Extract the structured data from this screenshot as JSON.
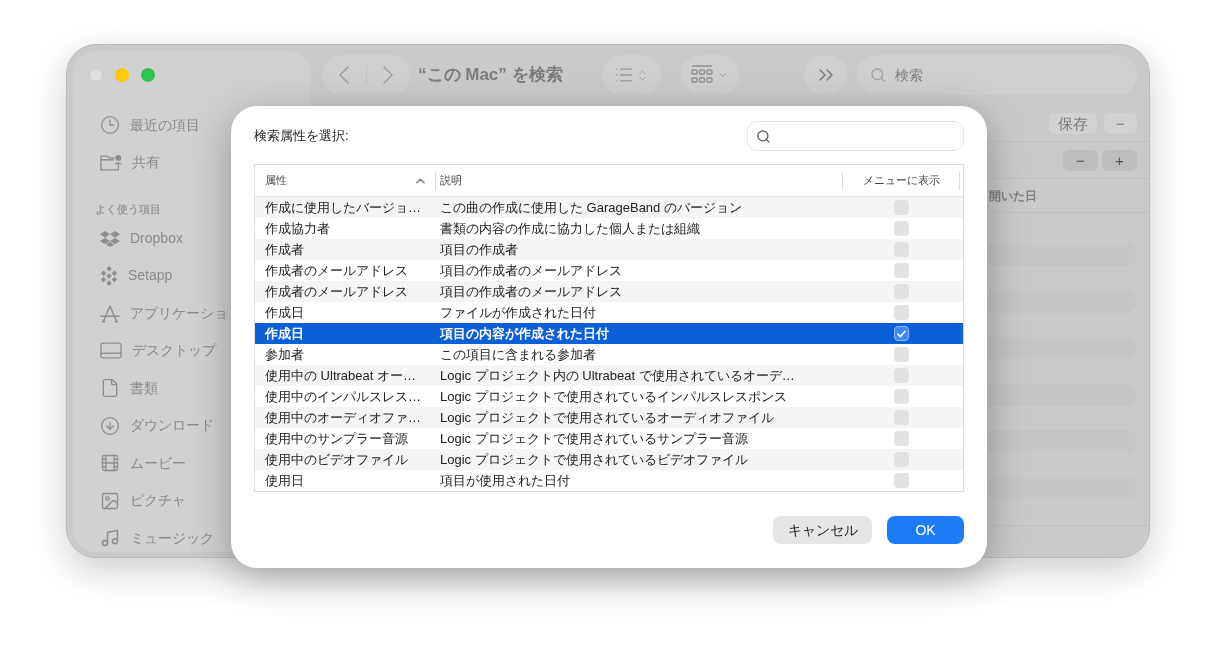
{
  "finder": {
    "title": "“この Mac” を検索",
    "search": {
      "placeholder": "検索"
    },
    "sidebar": {
      "items": [
        {
          "label": "最近の項目"
        },
        {
          "label": "共有"
        }
      ],
      "favorites": {
        "heading": "よく使う項目",
        "items": [
          {
            "label": "Dropbox"
          },
          {
            "label": "Setapp"
          },
          {
            "label": "アプリケーショ"
          },
          {
            "label": "デスクトップ"
          },
          {
            "label": "書類"
          },
          {
            "label": "ダウンロード"
          },
          {
            "label": "ムービー"
          },
          {
            "label": "ピクチャ"
          },
          {
            "label": "ミュージック"
          }
        ]
      }
    },
    "query_bar": {
      "buttons": [
        {
          "label": "保存",
          "disabled": true
        },
        {
          "label": "−",
          "disabled": true
        }
      ]
    },
    "criteria_bar": {
      "buttons": [
        {
          "label": "−",
          "disabled": false
        },
        {
          "label": "+",
          "disabled": false
        }
      ]
    },
    "columns": [
      {
        "label": "開いた日"
      }
    ]
  },
  "dialog": {
    "title": "検索属性を選択:",
    "table": {
      "columns": [
        {
          "label": "属性",
          "sorted": true
        },
        {
          "label": "説明",
          "sorted": false
        },
        {
          "label": "メニューに表示",
          "sorted": false
        }
      ],
      "rows": [
        {
          "attribute": "作成に使用したバージョ…",
          "description": "この曲の作成に使用した GarageBand のバージョン",
          "selected": false,
          "checked": false
        },
        {
          "attribute": "作成協力者",
          "description": "書類の内容の作成に協力した個人または組織",
          "selected": false,
          "checked": false
        },
        {
          "attribute": "作成者",
          "description": "項目の作成者",
          "selected": false,
          "checked": false
        },
        {
          "attribute": "作成者のメールアドレス",
          "description": "項目の作成者のメールアドレス",
          "selected": false,
          "checked": false
        },
        {
          "attribute": "作成者のメールアドレス",
          "description": "項目の作成者のメールアドレス",
          "selected": false,
          "checked": false
        },
        {
          "attribute": "作成日",
          "description": "ファイルが作成された日付",
          "selected": false,
          "checked": false
        },
        {
          "attribute": "作成日",
          "description": "項目の内容が作成された日付",
          "selected": true,
          "checked": true
        },
        {
          "attribute": "参加者",
          "description": "この項目に含まれる参加者",
          "selected": false,
          "checked": false
        },
        {
          "attribute": "使用中の Ultrabeat オー…",
          "description": "Logic プロジェクト内の Ultrabeat で使用されているオーデ…",
          "selected": false,
          "checked": false
        },
        {
          "attribute": "使用中のインパルスレス…",
          "description": "Logic プロジェクトで使用されているインパルスレスポンス",
          "selected": false,
          "checked": false
        },
        {
          "attribute": "使用中のオーディオファ…",
          "description": "Logic プロジェクトで使用されているオーディオファイル",
          "selected": false,
          "checked": false
        },
        {
          "attribute": "使用中のサンプラー音源",
          "description": "Logic プロジェクトで使用されているサンプラー音源",
          "selected": false,
          "checked": false
        },
        {
          "attribute": "使用中のビデオファイル",
          "description": "Logic プロジェクトで使用されているビデオファイル",
          "selected": false,
          "checked": false
        },
        {
          "attribute": "使用日",
          "description": "項目が使用された日付",
          "selected": false,
          "checked": false
        }
      ]
    },
    "buttons": [
      {
        "label": "キャンセル",
        "default": false
      },
      {
        "label": "OK",
        "default": true
      }
    ]
  }
}
